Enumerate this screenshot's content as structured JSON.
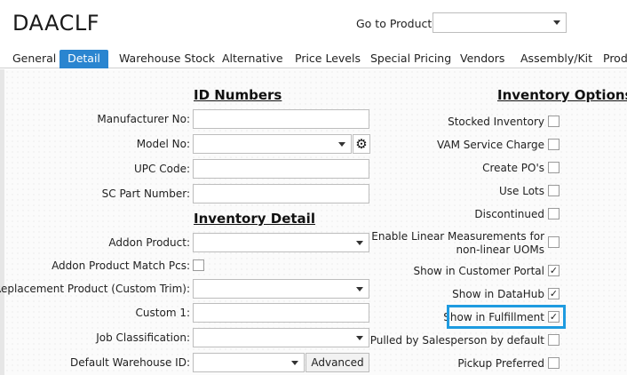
{
  "header": {
    "title": "DAACLF",
    "goto_label": "Go to Product:",
    "goto_value": ""
  },
  "tabs": [
    {
      "label": "General"
    },
    {
      "label": "Detail"
    },
    {
      "label": "Warehouse Stock"
    },
    {
      "label": "Alternative"
    },
    {
      "label": "Price Levels"
    },
    {
      "label": "Special Pricing"
    },
    {
      "label": "Vendors"
    },
    {
      "label": "Assembly/Kit"
    },
    {
      "label": "Produ"
    }
  ],
  "active_tab": "Detail",
  "id_numbers": {
    "title": "ID Numbers",
    "manufacturer_no_label": "Manufacturer No:",
    "model_no_label": "Model No:",
    "upc_code_label": "UPC Code:",
    "sc_part_number_label": "SC Part Number:",
    "manufacturer_no": "",
    "model_no": "",
    "upc_code": "",
    "sc_part_number": ""
  },
  "inventory_detail": {
    "title": "Inventory Detail",
    "addon_product_label": "Addon Product:",
    "addon_match_label": "Addon Product Match Pcs:",
    "replacement_label": "Replacement Product (Custom Trim):",
    "custom1_label": "Custom 1:",
    "job_class_label": "Job Classification:",
    "default_wh_label": "Default Warehouse ID:",
    "advanced_label": "Advanced"
  },
  "inventory_options": {
    "title": "Inventory Options",
    "items": [
      {
        "label": "Stocked Inventory",
        "checked": false
      },
      {
        "label": "VAM Service Charge",
        "checked": false
      },
      {
        "label": "Create PO's",
        "checked": false
      },
      {
        "label": "Use Lots",
        "checked": false
      },
      {
        "label": "Discontinued",
        "checked": false
      },
      {
        "label": "Enable Linear Measurements for",
        "label2": "non-linear UOMs",
        "checked": false
      },
      {
        "label": "Show in Customer Portal",
        "checked": true
      },
      {
        "label": "Show in DataHub",
        "checked": true
      },
      {
        "label": "Show in Fulfillment",
        "checked": true
      },
      {
        "label": "Pulled by Salesperson by default",
        "checked": false
      },
      {
        "label": "Pickup Preferred",
        "checked": false
      }
    ]
  },
  "colors": {
    "accent": "#2a85d0",
    "highlight": "#1e9be0"
  },
  "icons": {
    "gear": "gear-icon",
    "dropdown": "chevron-down-icon"
  }
}
